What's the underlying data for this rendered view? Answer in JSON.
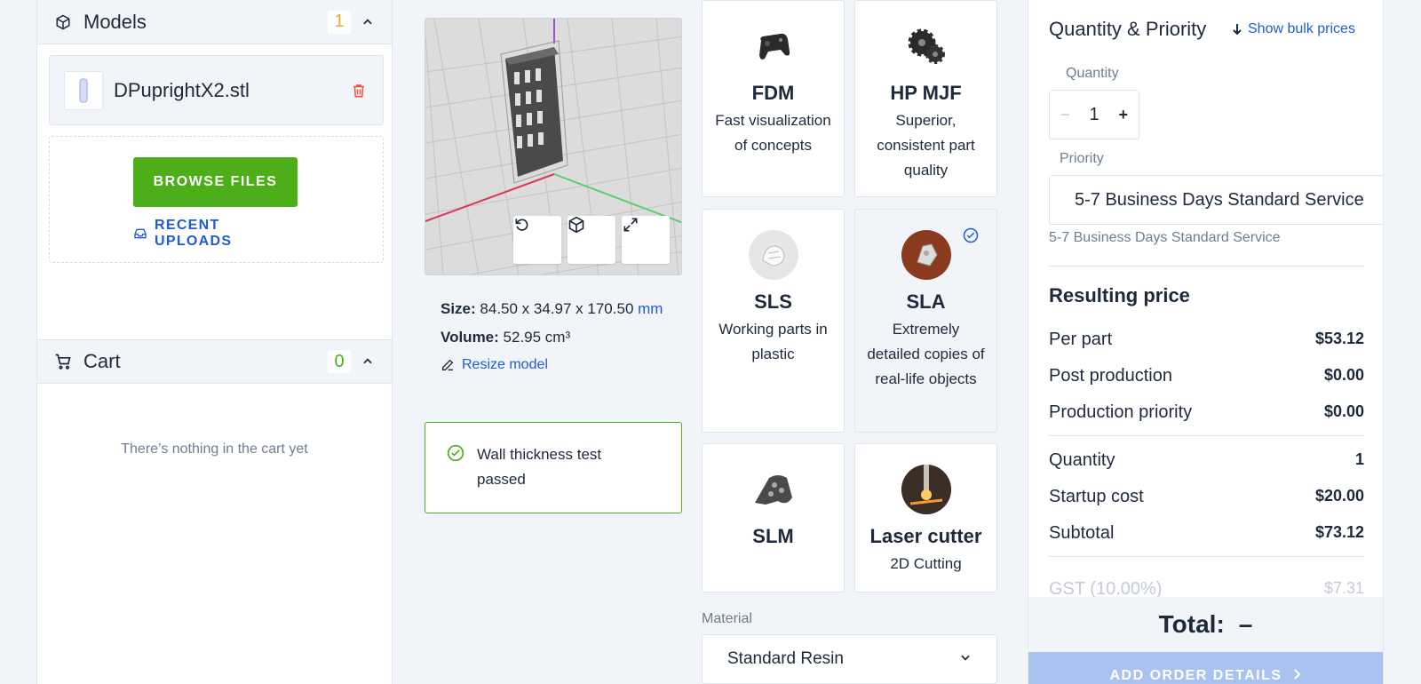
{
  "models": {
    "title": "Models",
    "count": "1",
    "file_name": "DPuprightX2.stl",
    "browse_label": "BROWSE FILES",
    "recent_label": "RECENT UPLOADS"
  },
  "cart": {
    "title": "Cart",
    "count": "0",
    "empty_text": "There’s nothing in the cart yet"
  },
  "model_info": {
    "size_label": "Size:",
    "size_value": "84.50 x 34.97 x 170.50",
    "size_unit": "mm",
    "volume_label": "Volume:",
    "volume_value": "52.95 cm³",
    "resize_label": "Resize model",
    "wall_test": "Wall thickness test passed"
  },
  "technologies": [
    {
      "name": "FDM",
      "desc": "Fast visualization of concepts",
      "icon": "gamepad-icon"
    },
    {
      "name": "HP MJF",
      "desc": "Superior, consistent part quality",
      "icon": "gears-icon"
    },
    {
      "name": "SLS",
      "desc": "Working parts in plastic",
      "icon": "sls-part-icon"
    },
    {
      "name": "SLA",
      "desc": "Extremely detailed copies of real-life objects",
      "icon": "sla-part-icon",
      "selected": true
    },
    {
      "name": "SLM",
      "desc": "",
      "icon": "metal-part-icon"
    },
    {
      "name": "Laser cutter",
      "desc": "2D Cutting",
      "icon": "laser-icon"
    }
  ],
  "material": {
    "label": "Material",
    "value": "Standard Resin"
  },
  "quantity_priority": {
    "title": "Quantity & Priority",
    "bulk_link": "Show bulk prices",
    "quantity_label": "Quantity",
    "quantity_value": "1",
    "minus": "−",
    "plus": "+",
    "priority_label": "Priority",
    "priority_value": "5-7 Business Days Standard Service",
    "priority_sub": "5-7 Business Days Standard Service"
  },
  "price": {
    "title": "Resulting price",
    "rows": [
      {
        "label": "Per part",
        "value": "$53.12"
      },
      {
        "label": "Post production",
        "value": "$0.00"
      },
      {
        "label": "Production priority",
        "value": "$0.00"
      },
      {
        "label": "Quantity",
        "value": "1"
      },
      {
        "label": "Startup cost",
        "value": "$20.00"
      },
      {
        "label": "Subtotal",
        "value": "$73.12"
      },
      {
        "label": "GST (10.00%)",
        "value": "$7.31"
      }
    ],
    "total_label": "Total:",
    "total_value": "–",
    "order_button": "ADD ORDER DETAILS"
  },
  "colors": {
    "accent": "#1f5dcf",
    "green": "#4caf1a",
    "count_orange": "#f5a623",
    "danger": "#e8533c"
  }
}
